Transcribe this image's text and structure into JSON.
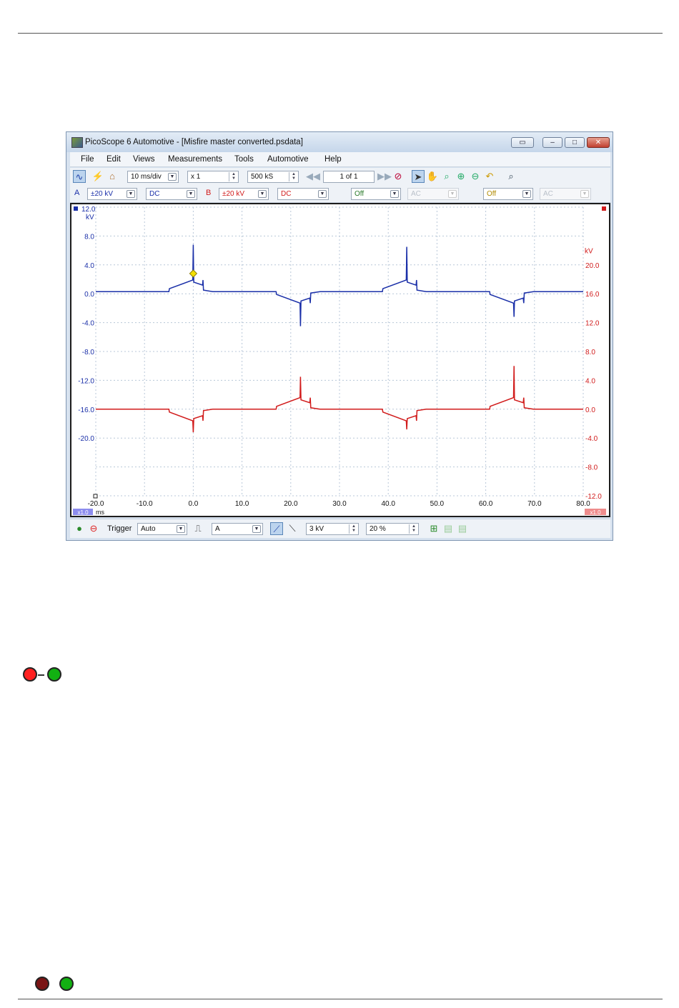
{
  "window": {
    "title": "PicoScope 6 Automotive - [Misfire master converted.psdata]",
    "buttons": [
      "",
      "",
      ""
    ]
  },
  "menu": [
    "File",
    "Edit",
    "Views",
    "Measurements",
    "Tools",
    "Automotive",
    "Help"
  ],
  "toolbar": {
    "timebase": "10 ms/div",
    "zoom": "x 1",
    "samples": "500 kS",
    "buffer": "1 of 1"
  },
  "channels": {
    "a": {
      "label": "A",
      "range": "±20 kV",
      "coupling": "DC"
    },
    "b": {
      "label": "B",
      "range": "±20 kV",
      "coupling": "DC"
    },
    "c": {
      "range": "Off",
      "coupling": "AC"
    },
    "d": {
      "range": "Off",
      "coupling": "AC"
    }
  },
  "bottom": {
    "trigger_label": "Trigger",
    "trigger_mode": "Auto",
    "trigger_source": "A",
    "threshold": "3 kV",
    "pretrigger": "20 %"
  },
  "colors": {
    "channel_a": "#1a2fa8",
    "channel_b": "#d11b1b",
    "grid": "#b8c7d8"
  },
  "chart_data": {
    "type": "line",
    "x_unit": "ms",
    "x_ticks": [
      "-20.0",
      "-10.0",
      "0.0",
      "10.0",
      "20.0",
      "30.0",
      "40.0",
      "50.0",
      "60.0",
      "70.0",
      "80.0"
    ],
    "xlim": [
      -20,
      80
    ],
    "left_axis": {
      "unit": "kV",
      "max_label": "12.0",
      "ticks": [
        "8.0",
        "4.0",
        "0.0",
        "-4.0",
        "-8.0",
        "-12.0",
        "-16.0",
        "-20.0"
      ],
      "ylim": [
        -28,
        12
      ],
      "scale_label": "x1.0"
    },
    "right_axis": {
      "unit": "kV",
      "ticks": [
        "20.0",
        "16.0",
        "12.0",
        "8.0",
        "4.0",
        "0.0",
        "-4.0",
        "-8.0",
        "-12.0"
      ],
      "ylim": [
        -12,
        28
      ],
      "scale_label": "x1.0"
    },
    "series": [
      {
        "name": "A",
        "axis": "left",
        "baseline": 0.3,
        "events": [
          {
            "x": 0.0,
            "kind": "spark",
            "peak": 6.8
          },
          {
            "x": 22.0,
            "kind": "neg",
            "peak": -4.5
          },
          {
            "x": 43.8,
            "kind": "spark",
            "peak": 6.5
          },
          {
            "x": 65.8,
            "kind": "neg",
            "peak": -3.2
          }
        ]
      },
      {
        "name": "B",
        "axis": "right",
        "baseline": 0.0,
        "events": [
          {
            "x": 0.0,
            "kind": "neg",
            "peak": -3.2
          },
          {
            "x": 22.0,
            "kind": "spark",
            "peak": 4.5
          },
          {
            "x": 43.8,
            "kind": "neg",
            "peak": -2.8
          },
          {
            "x": 65.8,
            "kind": "spark",
            "peak": 6.0
          }
        ]
      }
    ],
    "trigger_marker": {
      "x": 0.0,
      "y": 2.8
    }
  }
}
